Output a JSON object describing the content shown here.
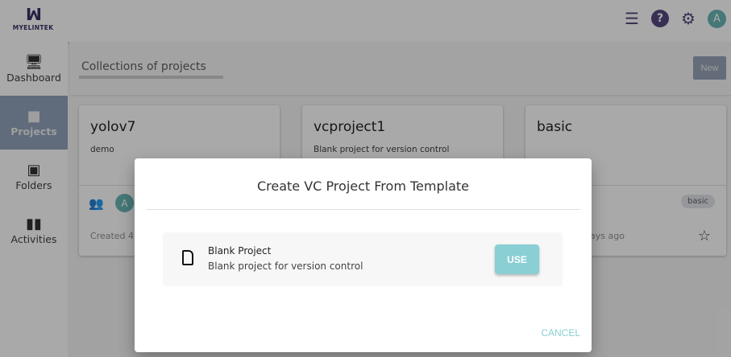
{
  "header": {
    "logo_text": "MyelinTek",
    "avatar": "A"
  },
  "sidebar": {
    "items": [
      {
        "label": "Dashboard"
      },
      {
        "label": "Projects"
      },
      {
        "label": "Folders"
      },
      {
        "label": "Activities"
      }
    ]
  },
  "topbar": {
    "title": "Collections of projects",
    "new_label": "New"
  },
  "cards": [
    {
      "title": "yolov7",
      "desc": "demo",
      "avatar": "A",
      "created": "Created 4"
    },
    {
      "title": "vcproject1",
      "desc": "Blank project for version control"
    },
    {
      "title": "basic",
      "desc": "",
      "tag": "basic",
      "created": "ays ago"
    }
  ],
  "modal": {
    "title": "Create VC Project From Template",
    "templates": [
      {
        "name": "Blank Project",
        "desc": "Blank project for version control",
        "use_label": "USE"
      }
    ],
    "cancel_label": "CANCEL"
  },
  "colors": {
    "accent": "#8acfd4",
    "brand": "#4b3a78"
  }
}
